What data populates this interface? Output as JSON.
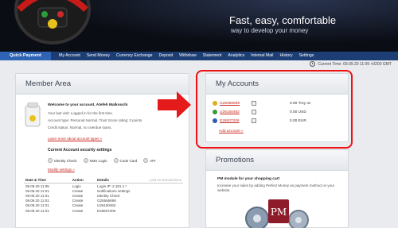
{
  "header": {
    "tagline_main": "Fast, easy, comfortable",
    "tagline_sub": "way to develop your money"
  },
  "nav": {
    "quick": "Quick Payment",
    "items": [
      "My Account",
      "Send Money",
      "Currency Exchange",
      "Deposit",
      "Withdraw",
      "Statement",
      "Analytics",
      "Internal Mail",
      "History",
      "Settings"
    ]
  },
  "status": {
    "time": "Current Time: 09.09.20 11:09 +0200 GMT"
  },
  "member": {
    "title": "Member Area",
    "welcome": "Welcome to your account, Atefeh Malkoochi",
    "last_visit": "Your last visit: Logged in for the first time.",
    "account_type": "Account type: Personal Normal. Trust Score rating: 0 points.",
    "credit_status": "Credit status: Normal, no overdue loans.",
    "learn_more": "Learn more about account types »",
    "security_title": "Current Account security settings",
    "security": [
      {
        "label": "Identity Check",
        "prefix": ""
      },
      {
        "label": "SMS Login",
        "prefix": "off"
      },
      {
        "label": "Code Card",
        "prefix": "off"
      },
      {
        "label": "API",
        "prefix": "off"
      }
    ],
    "modify": "Modify settings »",
    "history_headers": [
      "Date & Time",
      "Action",
      "Details",
      "Last 10 transactions"
    ],
    "history": [
      [
        "09.09.20 11:05",
        "Login",
        "Login IP: 2.181.1.*"
      ],
      [
        "09.09.20 11:01",
        "Create",
        "Notifications settings"
      ],
      [
        "09.09.20 11:01",
        "Create",
        "Identity Check"
      ],
      [
        "09.09.20 11:01",
        "Create",
        "G25566699"
      ],
      [
        "09.09.20 11:01",
        "Create",
        "U26150462"
      ],
      [
        "09.09.20 11:01",
        "Create",
        "E26837206"
      ]
    ]
  },
  "accounts": {
    "title": "My Accounts",
    "rows": [
      {
        "id": "G25566699",
        "value": "0.00 Troy oz",
        "color": "#e0b01a"
      },
      {
        "id": "U26150462",
        "value": "0.00 USD",
        "color": "#3a9a3a"
      },
      {
        "id": "E26837206",
        "value": "0.00 EUR",
        "color": "#2d5bb8"
      }
    ],
    "add": "Add account »"
  },
  "promotions": {
    "title": "Promotions",
    "heading": "PM module for your shopping cart",
    "text": "Increase your sales by adding Perfect Money as payment method on your website.",
    "logo_text": "PM"
  },
  "colors": {
    "nav_bg": "#1d3e74",
    "quick_bg": "#2f64b4",
    "link": "#c8251c",
    "highlight": "#e11111"
  }
}
